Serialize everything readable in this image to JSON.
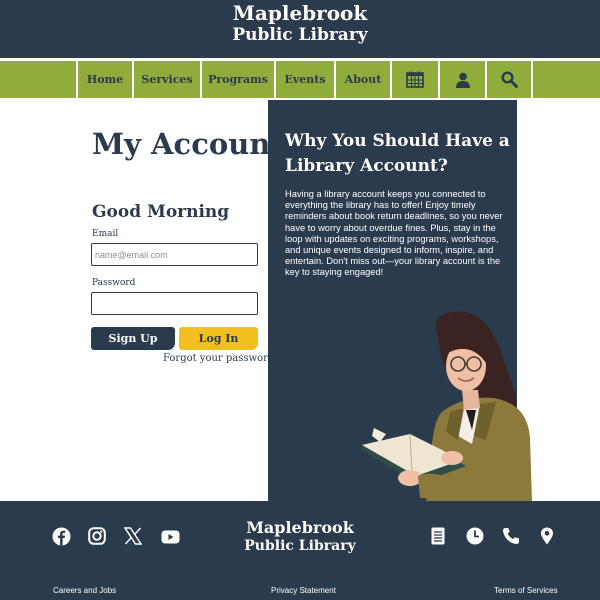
{
  "brand": {
    "line1": "Maplebrook",
    "line2": "Public Library"
  },
  "nav": {
    "items": [
      {
        "label": "Home"
      },
      {
        "label": "Services"
      },
      {
        "label": "Programs"
      },
      {
        "label": "Events"
      },
      {
        "label": "About"
      }
    ],
    "icons": [
      "calendar-icon",
      "user-icon",
      "search-icon"
    ]
  },
  "account": {
    "title": "My Account",
    "greeting": "Good Morning",
    "email_label": "Email",
    "email_placeholder": "name@email.com",
    "password_label": "Password",
    "signup_label": "Sign Up",
    "login_label": "Log In",
    "forgot_label": "Forgot your password"
  },
  "info": {
    "title": "Why You Should Have a Library Account?",
    "body": "Having a library account keeps you connected to everything the library has to offer! Enjoy timely reminders about book return deadlines, so you never have to worry about overdue fines. Plus, stay in the loop with updates on exciting programs, workshops, and unique events designed to inform, inspire, and entertain. Don't miss out—your library account is the key to staying engaged!"
  },
  "footer": {
    "social_icons": [
      "facebook-icon",
      "instagram-icon",
      "x-icon",
      "youtube-icon"
    ],
    "contact_icons": [
      "document-icon",
      "clock-icon",
      "phone-icon",
      "location-pin-icon"
    ],
    "links": {
      "careers": "Careers and Jobs",
      "privacy": "Privacy Statement",
      "terms": "Terms of Services"
    }
  },
  "colors": {
    "navy": "#2b3b4e",
    "green": "#8fac3c",
    "yellow": "#f2c01e",
    "white": "#ffffff"
  }
}
